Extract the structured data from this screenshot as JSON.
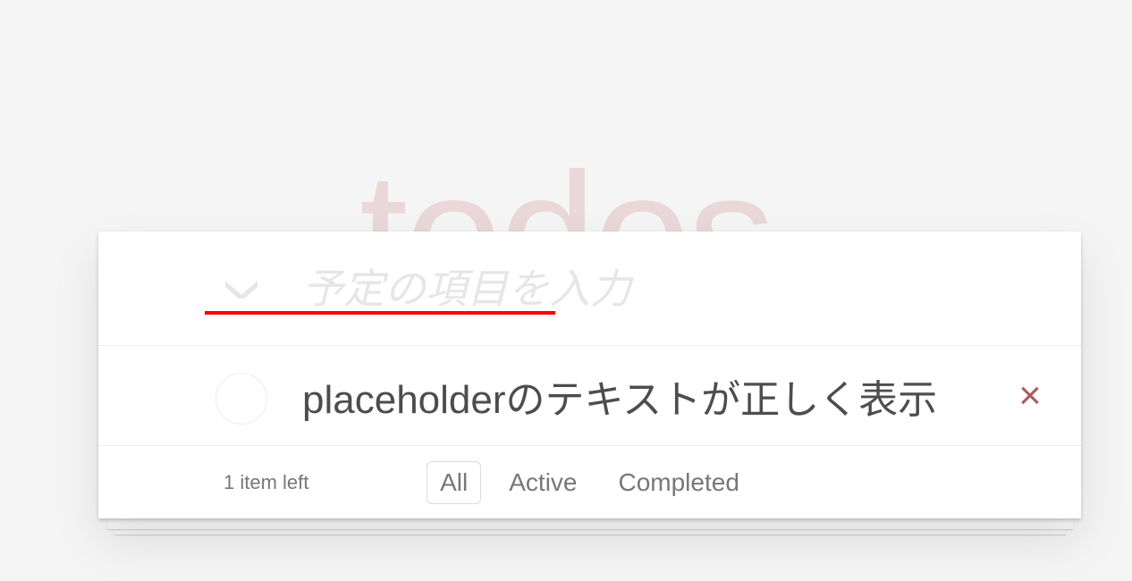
{
  "app": {
    "title": "todos"
  },
  "header": {
    "toggle_all_icon": "chevron-down-icon",
    "new_todo_value": "",
    "new_todo_placeholder": "予定の項目を入力",
    "annotation": {
      "type": "red-underline",
      "color": "#ff0000"
    }
  },
  "todos": [
    {
      "title": "placeholderのテキストが正しく表示",
      "completed": false,
      "destroy_label": "×"
    }
  ],
  "footer": {
    "count_text": "1 item left",
    "filters": [
      {
        "label": "All",
        "selected": true
      },
      {
        "label": "Active",
        "selected": false
      },
      {
        "label": "Completed",
        "selected": false
      }
    ]
  },
  "colors": {
    "background": "#f5f5f5",
    "card": "#ffffff",
    "title": "#ead7d7",
    "text": "#4d4d4d",
    "muted": "#777777",
    "placeholder": "#e6e6e6",
    "destroy": "#af5b5e",
    "accent_border": "rgba(175,47,47,0.2)",
    "annotation": "#ff0000"
  }
}
